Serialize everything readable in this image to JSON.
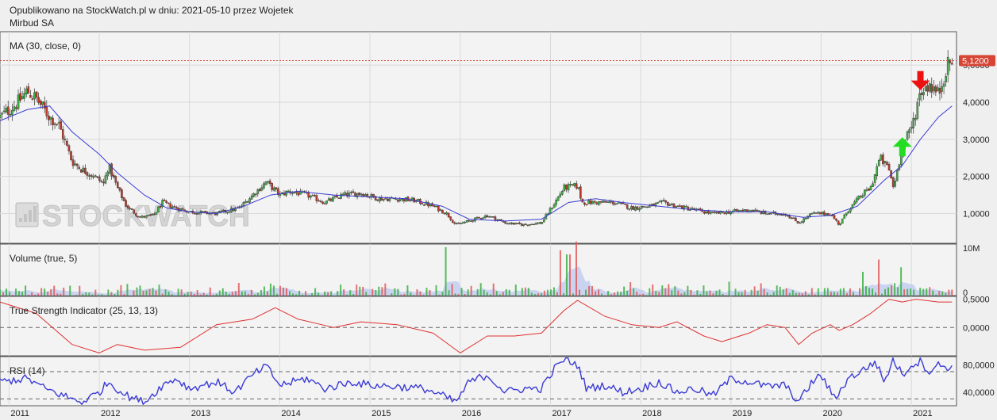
{
  "header": {
    "published": "Opublikowano na StockWatch.pl w dniu: 2021-05-10 przez Wojetek",
    "ticker_name": "Mirbud SA"
  },
  "watermark": "STOCKWATCH",
  "colors": {
    "up": "#3cb043",
    "down": "#c0392b",
    "ma": "#3b3bd6",
    "tsi": "#e03030",
    "rsi": "#3b3bd6",
    "last_price_tag": "#d64535",
    "arrow_up": "#22dd22",
    "arrow_down": "#ee1111",
    "grid": "#d9d9d9",
    "panel_bg": "#f3f3f3"
  },
  "chart_data": [
    {
      "panel": "price",
      "type": "candlestick",
      "indicator_label": "MA (30, close, 0)",
      "y_ticks": [
        "1,0000",
        "2,0000",
        "3,0000",
        "4,0000",
        "5,0000"
      ],
      "ylim": [
        0.2,
        5.9
      ],
      "last_price_label": "5,1200",
      "last_price": 5.12,
      "x_labels": [
        "2011",
        "2012",
        "2013",
        "2014",
        "2015",
        "2016",
        "2017",
        "2018",
        "2019",
        "2020",
        "2021"
      ],
      "xlim": [
        2010.9,
        2021.5
      ],
      "price_points": [
        [
          2010.9,
          3.6
        ],
        [
          2011.1,
          4.0
        ],
        [
          2011.2,
          4.3
        ],
        [
          2011.3,
          4.1
        ],
        [
          2011.45,
          3.6
        ],
        [
          2011.55,
          3.4
        ],
        [
          2011.7,
          2.4
        ],
        [
          2011.8,
          2.2
        ],
        [
          2011.95,
          2.0
        ],
        [
          2012.05,
          1.8
        ],
        [
          2012.1,
          2.3
        ],
        [
          2012.2,
          1.7
        ],
        [
          2012.3,
          1.2
        ],
        [
          2012.45,
          0.9
        ],
        [
          2012.6,
          0.95
        ],
        [
          2012.7,
          1.3
        ],
        [
          2012.85,
          1.15
        ],
        [
          2013.0,
          1.05
        ],
        [
          2013.3,
          1.0
        ],
        [
          2013.55,
          1.15
        ],
        [
          2013.7,
          1.5
        ],
        [
          2013.85,
          1.85
        ],
        [
          2014.0,
          1.5
        ],
        [
          2014.1,
          1.6
        ],
        [
          2014.3,
          1.5
        ],
        [
          2014.5,
          1.3
        ],
        [
          2014.7,
          1.5
        ],
        [
          2014.9,
          1.55
        ],
        [
          2015.1,
          1.4
        ],
        [
          2015.3,
          1.4
        ],
        [
          2015.5,
          1.35
        ],
        [
          2015.7,
          1.2
        ],
        [
          2015.85,
          1.0
        ],
        [
          2015.95,
          0.7
        ],
        [
          2016.1,
          0.8
        ],
        [
          2016.3,
          0.95
        ],
        [
          2016.5,
          0.75
        ],
        [
          2016.7,
          0.7
        ],
        [
          2016.9,
          0.75
        ],
        [
          2017.05,
          1.3
        ],
        [
          2017.15,
          1.7
        ],
        [
          2017.3,
          1.75
        ],
        [
          2017.35,
          1.3
        ],
        [
          2017.5,
          1.3
        ],
        [
          2017.7,
          1.3
        ],
        [
          2017.9,
          1.15
        ],
        [
          2018.1,
          1.2
        ],
        [
          2018.25,
          1.3
        ],
        [
          2018.4,
          1.2
        ],
        [
          2018.6,
          1.1
        ],
        [
          2018.8,
          1.0
        ],
        [
          2019.0,
          1.05
        ],
        [
          2019.2,
          1.1
        ],
        [
          2019.4,
          1.0
        ],
        [
          2019.6,
          1.0
        ],
        [
          2019.75,
          0.75
        ],
        [
          2019.9,
          1.0
        ],
        [
          2020.0,
          1.0
        ],
        [
          2020.1,
          1.0
        ],
        [
          2020.2,
          0.7
        ],
        [
          2020.3,
          1.1
        ],
        [
          2020.45,
          1.5
        ],
        [
          2020.55,
          1.7
        ],
        [
          2020.65,
          2.5
        ],
        [
          2020.75,
          2.2
        ],
        [
          2020.8,
          1.7
        ],
        [
          2020.9,
          2.8
        ],
        [
          2021.0,
          3.3
        ],
        [
          2021.1,
          4.3
        ],
        [
          2021.2,
          4.5
        ],
        [
          2021.3,
          4.2
        ],
        [
          2021.38,
          4.9
        ],
        [
          2021.45,
          5.12
        ]
      ],
      "ma_points": [
        [
          2010.9,
          3.5
        ],
        [
          2011.2,
          3.8
        ],
        [
          2011.45,
          3.9
        ],
        [
          2011.7,
          3.2
        ],
        [
          2012.0,
          2.6
        ],
        [
          2012.2,
          2.1
        ],
        [
          2012.5,
          1.5
        ],
        [
          2012.75,
          1.15
        ],
        [
          2013.0,
          1.05
        ],
        [
          2013.3,
          1.0
        ],
        [
          2013.6,
          1.2
        ],
        [
          2013.9,
          1.5
        ],
        [
          2014.2,
          1.6
        ],
        [
          2014.6,
          1.5
        ],
        [
          2015.0,
          1.45
        ],
        [
          2015.4,
          1.4
        ],
        [
          2015.8,
          1.2
        ],
        [
          2016.1,
          0.85
        ],
        [
          2016.5,
          0.8
        ],
        [
          2016.9,
          0.85
        ],
        [
          2017.2,
          1.3
        ],
        [
          2017.5,
          1.4
        ],
        [
          2017.8,
          1.3
        ],
        [
          2018.2,
          1.2
        ],
        [
          2018.6,
          1.1
        ],
        [
          2019.0,
          1.05
        ],
        [
          2019.4,
          1.05
        ],
        [
          2019.8,
          0.9
        ],
        [
          2020.1,
          0.95
        ],
        [
          2020.4,
          1.2
        ],
        [
          2020.7,
          1.9
        ],
        [
          2020.9,
          2.3
        ],
        [
          2021.1,
          3.0
        ],
        [
          2021.3,
          3.6
        ],
        [
          2021.45,
          3.9
        ]
      ],
      "annotations": [
        {
          "kind": "arrow-up",
          "x": 2020.9,
          "y": 2.8
        },
        {
          "kind": "arrow-down",
          "x": 2021.1,
          "y": 4.5
        }
      ]
    },
    {
      "panel": "volume",
      "type": "bar",
      "indicator_label": "Volume (true, 5)",
      "y_ticks": [
        "0",
        "10M"
      ],
      "ylim": [
        0,
        10000000
      ],
      "spikes": [
        [
          2015.85,
          9400000
        ],
        [
          2017.1,
          8800000
        ],
        [
          2017.2,
          8000000
        ],
        [
          2017.3,
          10500000
        ],
        [
          2020.65,
          7000000
        ],
        [
          2020.9,
          5500000
        ],
        [
          2020.45,
          4600000
        ]
      ],
      "baseline_max": 2800000
    },
    {
      "panel": "tsi",
      "type": "line",
      "indicator_label": "True Strength Indicator (25, 13, 13)",
      "y_ticks": [
        "0,0000",
        "0,5000"
      ],
      "ylim": [
        -0.5,
        0.55
      ],
      "points": [
        [
          2010.9,
          0.45
        ],
        [
          2011.3,
          0.25
        ],
        [
          2011.7,
          -0.3
        ],
        [
          2012.0,
          -0.45
        ],
        [
          2012.2,
          -0.3
        ],
        [
          2012.5,
          -0.4
        ],
        [
          2012.9,
          -0.35
        ],
        [
          2013.3,
          0.05
        ],
        [
          2013.7,
          0.15
        ],
        [
          2013.95,
          0.35
        ],
        [
          2014.2,
          0.15
        ],
        [
          2014.6,
          0.0
        ],
        [
          2014.9,
          0.1
        ],
        [
          2015.3,
          0.05
        ],
        [
          2015.7,
          -0.1
        ],
        [
          2016.0,
          -0.45
        ],
        [
          2016.3,
          -0.15
        ],
        [
          2016.6,
          -0.15
        ],
        [
          2016.9,
          -0.1
        ],
        [
          2017.15,
          0.3
        ],
        [
          2017.3,
          0.48
        ],
        [
          2017.6,
          0.2
        ],
        [
          2017.9,
          0.05
        ],
        [
          2018.2,
          0.0
        ],
        [
          2018.4,
          0.1
        ],
        [
          2018.7,
          -0.15
        ],
        [
          2018.9,
          -0.25
        ],
        [
          2019.2,
          -0.1
        ],
        [
          2019.4,
          0.05
        ],
        [
          2019.6,
          0.0
        ],
        [
          2019.75,
          -0.3
        ],
        [
          2019.9,
          -0.1
        ],
        [
          2020.1,
          0.05
        ],
        [
          2020.2,
          -0.05
        ],
        [
          2020.35,
          0.05
        ],
        [
          2020.55,
          0.25
        ],
        [
          2020.75,
          0.5
        ],
        [
          2020.9,
          0.45
        ],
        [
          2021.05,
          0.5
        ],
        [
          2021.3,
          0.45
        ],
        [
          2021.45,
          0.45
        ]
      ]
    },
    {
      "panel": "rsi",
      "type": "line",
      "indicator_label": "RSI (14)",
      "y_ticks": [
        "40,0000",
        "80,0000"
      ],
      "ylim": [
        20,
        92
      ],
      "levels": [
        70,
        30
      ],
      "points": [
        [
          2010.9,
          55
        ],
        [
          2011.2,
          60
        ],
        [
          2011.4,
          45
        ],
        [
          2011.6,
          35
        ],
        [
          2011.8,
          25
        ],
        [
          2012.0,
          40
        ],
        [
          2012.1,
          55
        ],
        [
          2012.3,
          35
        ],
        [
          2012.5,
          25
        ],
        [
          2012.7,
          50
        ],
        [
          2012.85,
          60
        ],
        [
          2013.0,
          45
        ],
        [
          2013.3,
          55
        ],
        [
          2013.5,
          40
        ],
        [
          2013.7,
          65
        ],
        [
          2013.85,
          78
        ],
        [
          2014.0,
          50
        ],
        [
          2014.3,
          60
        ],
        [
          2014.5,
          45
        ],
        [
          2014.8,
          55
        ],
        [
          2015.0,
          50
        ],
        [
          2015.3,
          48
        ],
        [
          2015.6,
          45
        ],
        [
          2015.8,
          35
        ],
        [
          2015.95,
          25
        ],
        [
          2016.1,
          55
        ],
        [
          2016.3,
          65
        ],
        [
          2016.5,
          40
        ],
        [
          2016.7,
          45
        ],
        [
          2016.9,
          45
        ],
        [
          2017.05,
          75
        ],
        [
          2017.15,
          88
        ],
        [
          2017.3,
          80
        ],
        [
          2017.4,
          45
        ],
        [
          2017.6,
          50
        ],
        [
          2017.8,
          40
        ],
        [
          2018.0,
          45
        ],
        [
          2018.2,
          55
        ],
        [
          2018.4,
          40
        ],
        [
          2018.6,
          45
        ],
        [
          2018.8,
          35
        ],
        [
          2019.0,
          60
        ],
        [
          2019.2,
          55
        ],
        [
          2019.4,
          48
        ],
        [
          2019.6,
          50
        ],
        [
          2019.75,
          25
        ],
        [
          2019.9,
          55
        ],
        [
          2020.0,
          65
        ],
        [
          2020.15,
          30
        ],
        [
          2020.3,
          60
        ],
        [
          2020.5,
          75
        ],
        [
          2020.6,
          85
        ],
        [
          2020.7,
          55
        ],
        [
          2020.8,
          88
        ],
        [
          2020.9,
          65
        ],
        [
          2021.0,
          80
        ],
        [
          2021.1,
          85
        ],
        [
          2021.2,
          70
        ],
        [
          2021.3,
          80
        ],
        [
          2021.45,
          75
        ]
      ]
    }
  ]
}
